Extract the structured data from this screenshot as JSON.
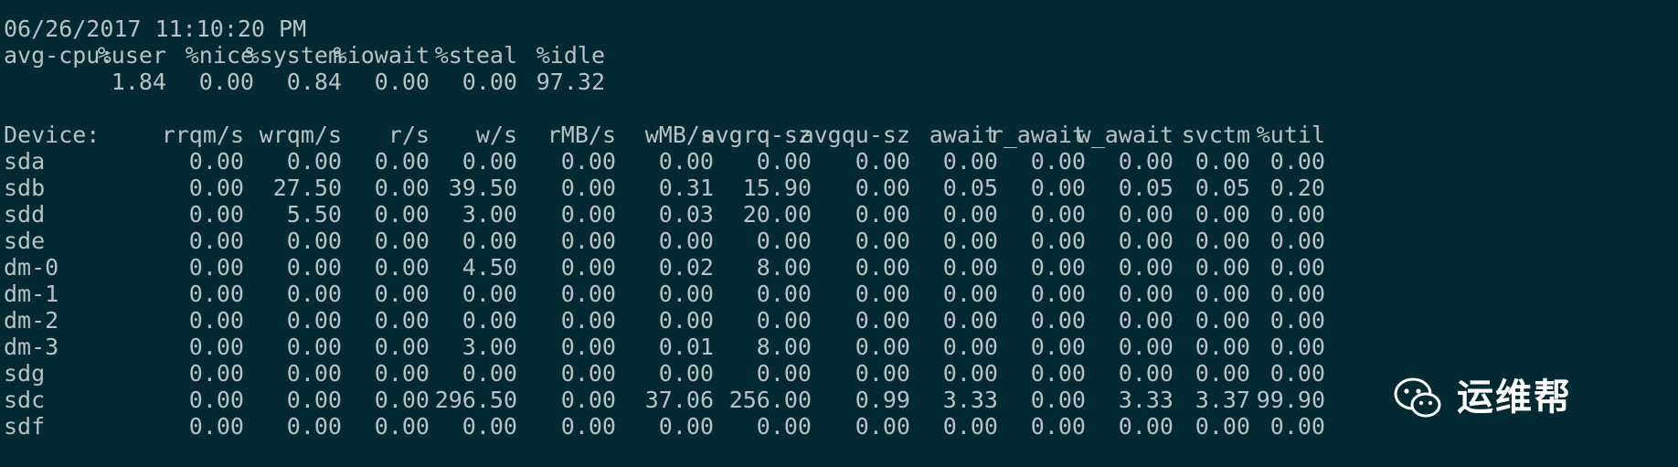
{
  "timestamp": "06/26/2017 11:10:20 PM",
  "cpu": {
    "label": "avg-cpu:",
    "headers": [
      "%user",
      "%nice",
      "%system",
      "%iowait",
      "%steal",
      "%idle"
    ],
    "values": [
      "1.84",
      "0.00",
      "0.84",
      "0.00",
      "0.00",
      "97.32"
    ]
  },
  "device_table": {
    "headers": [
      "Device:",
      "rrqm/s",
      "wrqm/s",
      "r/s",
      "w/s",
      "rMB/s",
      "wMB/s",
      "avgrq-sz",
      "avgqu-sz",
      "await",
      "r_await",
      "w_await",
      "svctm",
      "%util"
    ],
    "rows": [
      [
        "sda",
        "0.00",
        "0.00",
        "0.00",
        "0.00",
        "0.00",
        "0.00",
        "0.00",
        "0.00",
        "0.00",
        "0.00",
        "0.00",
        "0.00",
        "0.00"
      ],
      [
        "sdb",
        "0.00",
        "27.50",
        "0.00",
        "39.50",
        "0.00",
        "0.31",
        "15.90",
        "0.00",
        "0.05",
        "0.00",
        "0.05",
        "0.05",
        "0.20"
      ],
      [
        "sdd",
        "0.00",
        "5.50",
        "0.00",
        "3.00",
        "0.00",
        "0.03",
        "20.00",
        "0.00",
        "0.00",
        "0.00",
        "0.00",
        "0.00",
        "0.00"
      ],
      [
        "sde",
        "0.00",
        "0.00",
        "0.00",
        "0.00",
        "0.00",
        "0.00",
        "0.00",
        "0.00",
        "0.00",
        "0.00",
        "0.00",
        "0.00",
        "0.00"
      ],
      [
        "dm-0",
        "0.00",
        "0.00",
        "0.00",
        "4.50",
        "0.00",
        "0.02",
        "8.00",
        "0.00",
        "0.00",
        "0.00",
        "0.00",
        "0.00",
        "0.00"
      ],
      [
        "dm-1",
        "0.00",
        "0.00",
        "0.00",
        "0.00",
        "0.00",
        "0.00",
        "0.00",
        "0.00",
        "0.00",
        "0.00",
        "0.00",
        "0.00",
        "0.00"
      ],
      [
        "dm-2",
        "0.00",
        "0.00",
        "0.00",
        "0.00",
        "0.00",
        "0.00",
        "0.00",
        "0.00",
        "0.00",
        "0.00",
        "0.00",
        "0.00",
        "0.00"
      ],
      [
        "dm-3",
        "0.00",
        "0.00",
        "0.00",
        "3.00",
        "0.00",
        "0.01",
        "8.00",
        "0.00",
        "0.00",
        "0.00",
        "0.00",
        "0.00",
        "0.00"
      ],
      [
        "sdg",
        "0.00",
        "0.00",
        "0.00",
        "0.00",
        "0.00",
        "0.00",
        "0.00",
        "0.00",
        "0.00",
        "0.00",
        "0.00",
        "0.00",
        "0.00"
      ],
      [
        "sdc",
        "0.00",
        "0.00",
        "0.00",
        "296.50",
        "0.00",
        "37.06",
        "256.00",
        "0.99",
        "3.33",
        "0.00",
        "3.33",
        "3.37",
        "99.90"
      ],
      [
        "sdf",
        "0.00",
        "0.00",
        "0.00",
        "0.00",
        "0.00",
        "0.00",
        "0.00",
        "0.00",
        "0.00",
        "0.00",
        "0.00",
        "0.00",
        "0.00"
      ]
    ]
  },
  "watermark": {
    "text": "运维帮",
    "icon": "wechat-icon"
  },
  "colors": {
    "background": "#032a33",
    "foreground": "#b9c2c1"
  }
}
